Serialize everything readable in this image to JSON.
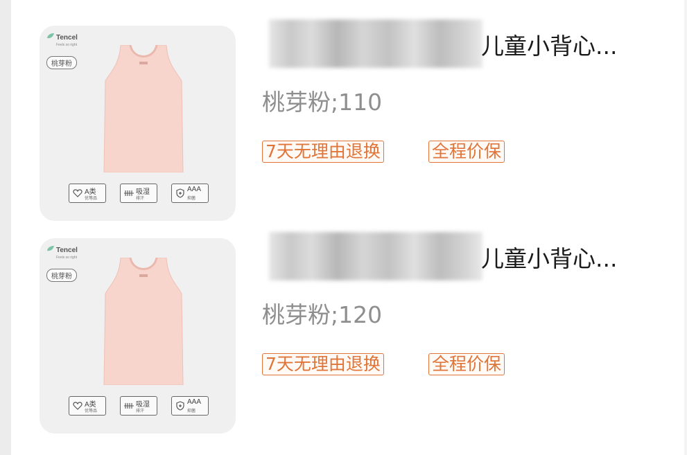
{
  "items": [
    {
      "title_visible": "儿童小背心...",
      "variant": "桃芽粉;110",
      "tags": [
        "7天无理由退换",
        "全程价保"
      ],
      "thumbnail": {
        "brand": "Tencel",
        "brand_tagline": "Feels so right",
        "color_label": "桃芽粉",
        "garment_color": "#f7d4cc",
        "badges": [
          {
            "icon": "heart-icon",
            "top": "A类",
            "bottom": "优等品"
          },
          {
            "icon": "moisture-icon",
            "top": "吸湿",
            "bottom": "排汗"
          },
          {
            "icon": "shield-icon",
            "top": "AAA",
            "bottom": "抑菌"
          }
        ]
      }
    },
    {
      "title_visible": "儿童小背心...",
      "variant": "桃芽粉;120",
      "tags": [
        "7天无理由退换",
        "全程价保"
      ],
      "thumbnail": {
        "brand": "Tencel",
        "brand_tagline": "Feels so right",
        "color_label": "桃芽粉",
        "garment_color": "#f7d4cc",
        "badges": [
          {
            "icon": "heart-icon",
            "top": "A类",
            "bottom": "优等品"
          },
          {
            "icon": "moisture-icon",
            "top": "吸湿",
            "bottom": "排汗"
          },
          {
            "icon": "shield-icon",
            "top": "AAA",
            "bottom": "抑菌"
          }
        ]
      }
    }
  ],
  "colors": {
    "tag_accent": "#e0753a",
    "variant_text": "#8e8e8e",
    "title_text": "#1a1a1a",
    "thumb_bg": "#f0f0f0"
  }
}
